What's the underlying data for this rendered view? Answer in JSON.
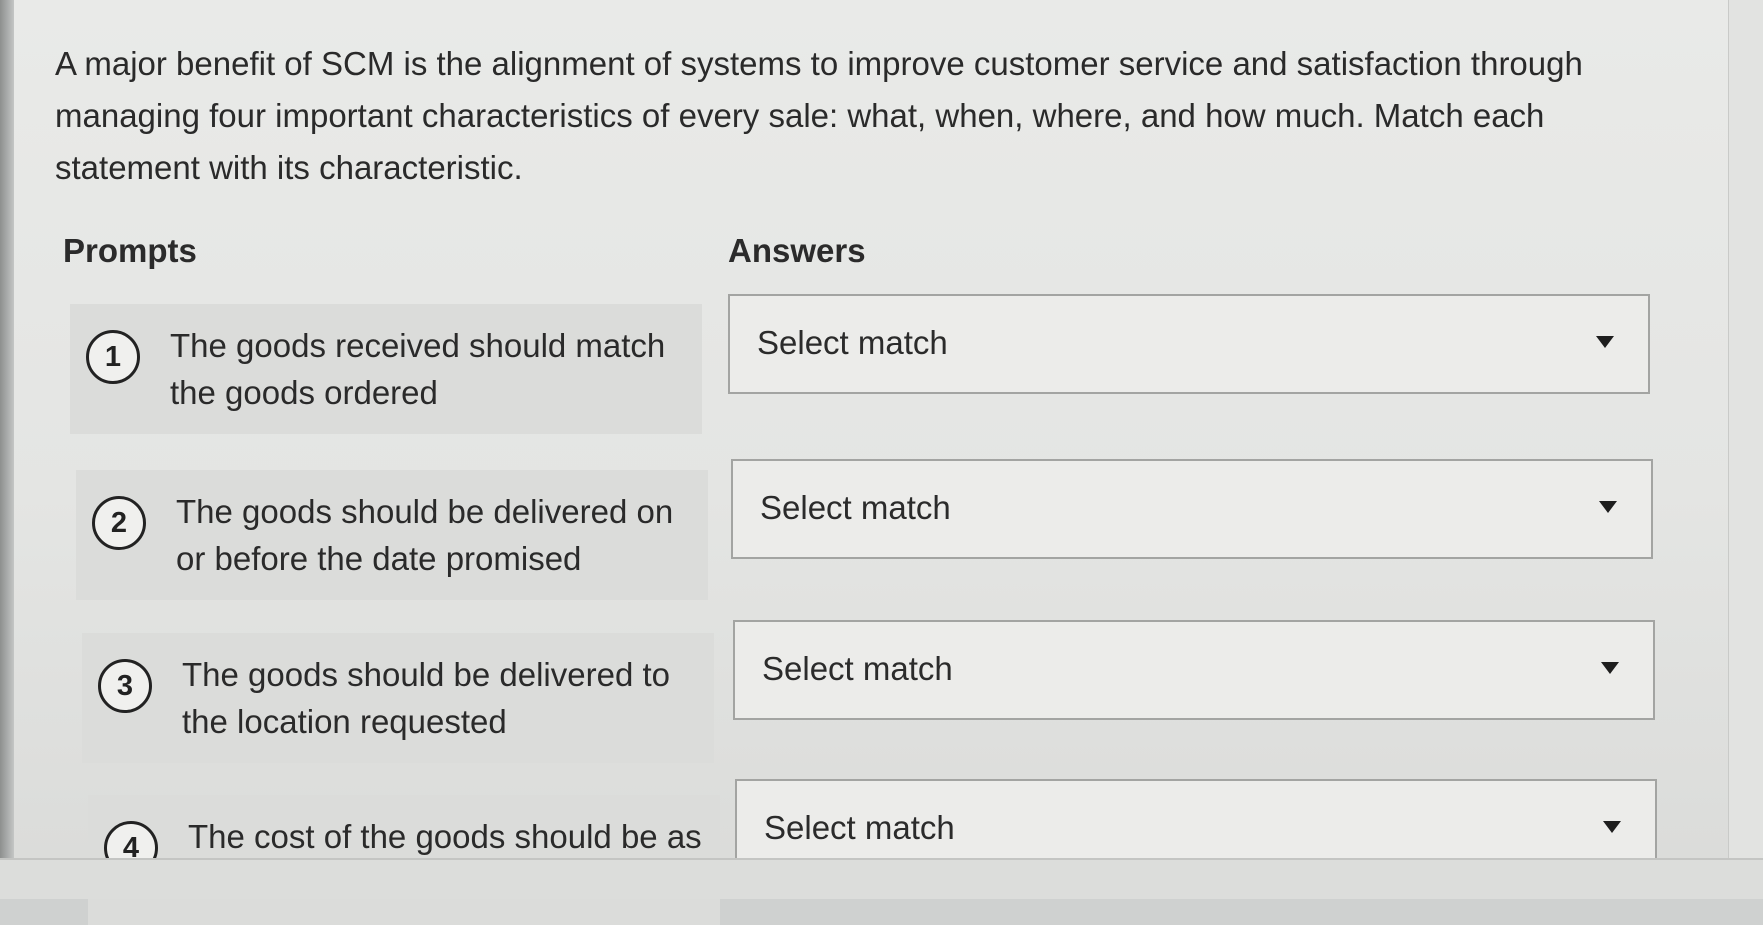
{
  "question": "A major benefit of SCM is the alignment of systems to improve customer service and satisfaction through managing four important characteristics of every sale: what, when, where, and how much. Match each statement with its characteristic.",
  "headers": {
    "prompts": "Prompts",
    "answers": "Answers"
  },
  "prompts": [
    {
      "number": "1",
      "text": "The goods received should match the goods ordered"
    },
    {
      "number": "2",
      "text": "The goods should be delivered on or before the date promised"
    },
    {
      "number": "3",
      "text": "The goods should be delivered to the location requested"
    },
    {
      "number": "4",
      "text": "The cost of the goods should be as"
    }
  ],
  "answers": [
    {
      "value": "Select match",
      "icon": "chevron-down-icon"
    },
    {
      "value": "Select match",
      "icon": "chevron-down-icon"
    },
    {
      "value": "Select match",
      "icon": "chevron-down-icon"
    },
    {
      "value": "Select match",
      "icon": "chevron-down-icon"
    }
  ]
}
